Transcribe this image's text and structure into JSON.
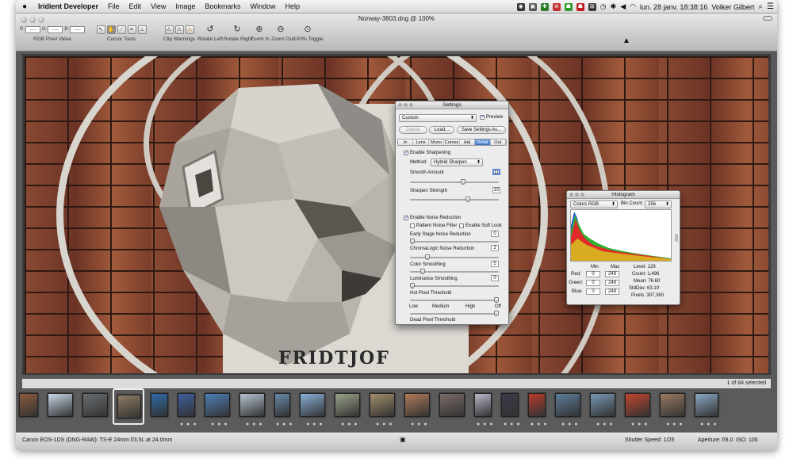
{
  "menubar": {
    "app": "Iridient Developer",
    "menus": [
      "File",
      "Edit",
      "View",
      "Image",
      "Bookmarks",
      "Window",
      "Help"
    ],
    "datetime": "lun. 28 janv.  18:38:16",
    "user": "Volker Gilbert"
  },
  "window": {
    "title": "Norway-3803.dng @ 100%"
  },
  "toolbar": {
    "rgb_label": "RGB Pixel Value",
    "rgb_r": "R:",
    "rgb_g": "G:",
    "rgb_b": "B:",
    "rgb_placeholder": "-----",
    "cursor_tools": "Cursor Tools",
    "clip_warnings": "Clip Warnings",
    "rotate_left": "Rotate Left",
    "rotate_right": "Rotate Right",
    "zoom_in": "Zoom In",
    "zoom_out": "Zoom Out",
    "toggle_100": "100% Toggle"
  },
  "photo": {
    "caption": "FRIDTJOF"
  },
  "selection_info": "1 of 84 selected",
  "filmstrip": {
    "thumb_colors": [
      "#8b5a3c",
      "#c9d6e6",
      "#6a6e72",
      "#8e7a62",
      "#2d6aa6",
      "#3f5fa0",
      "#4e7fb8",
      "#b7c4d2",
      "#6788a8",
      "#8ab0d8",
      "#9aa38a",
      "#a28e6a",
      "#b07a5a",
      "#7a6c66",
      "#b8b8c8",
      "#3b3b4a",
      "#b53b2c",
      "#5d7d9a",
      "#7898b4",
      "#c0462c",
      "#9a7a62",
      "#8aa8c4"
    ],
    "dots": "● ● ●"
  },
  "status": {
    "camera": "Canon EOS-1DS (DNG-RAW): TS-E 24mm f/3.5L at 24.0mm",
    "shutter": "Shutter Speed: 1/25",
    "aperture": "Aperture: f/8.0",
    "iso": "ISO: 100"
  },
  "settings": {
    "title": "Settings",
    "preset": "Custom",
    "preview_label": "Preview",
    "preview_checked": true,
    "delete": "Delete",
    "load": "Load...",
    "save": "Save Settings As...",
    "tabs": [
      "In",
      "Lens",
      "Mono",
      "Curves",
      "Adj",
      "Detail",
      "Out"
    ],
    "active_tab": "Detail",
    "enable_sharpening": "Enable Sharpening",
    "method_label": "Method:",
    "method_value": "Hybrid Sharpen",
    "smooth_amount_label": "Smooth Amount",
    "smooth_amount_value": "11",
    "smooth_amount_level": 0.6,
    "sharpen_strength_label": "Sharpen Strength",
    "sharpen_strength_value": "10",
    "sharpen_strength_level": 0.66,
    "enable_noise": "Enable Noise Reduction",
    "pattern_noise": "Pattern Noise Filter",
    "soft_look": "Enable Soft Look",
    "early_stage_label": "Early Stage Noise Reduction",
    "early_stage_value": "0",
    "early_stage_level": 0.0,
    "chromalogic_label": "ChromaLogic Noise Reduction",
    "chromalogic_value": "2",
    "chromalogic_level": 0.18,
    "color_smoothing_label": "Color Smoothing",
    "color_smoothing_value": "5",
    "color_smoothing_level": 0.12,
    "luminance_label": "Luminance Smoothing",
    "luminance_value": "0",
    "luminance_level": 0.0,
    "hot_pixel_label": "Hot Pixel Threshold",
    "hot_pixel_level": 1.0,
    "threshold_ticks": [
      "Low",
      "Medium",
      "High",
      "Off"
    ],
    "dead_pixel_label": "Dead Pixel Threshold",
    "dead_pixel_level": 1.0
  },
  "histogram": {
    "title": "Histogram",
    "mode": "Colors RGB",
    "bin_label": "Bin Count:",
    "bin_value": "256",
    "min_label": "Min",
    "max_label": "Max",
    "rows": [
      {
        "label": "Red:",
        "min": "0",
        "max": "249"
      },
      {
        "label": "Green:",
        "min": "0",
        "max": "249"
      },
      {
        "label": "Blue:",
        "min": "0",
        "max": "248"
      }
    ],
    "stats": [
      "Level: 128",
      "Count: 1,496",
      "Mean: 76.60",
      "StdDev: 63.19",
      "Pixels: 307,360"
    ]
  }
}
